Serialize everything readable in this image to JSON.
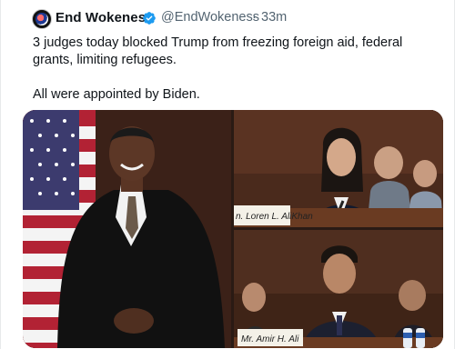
{
  "tweet": {
    "author_name": "End Wokeness",
    "handle": "@EndWokeness",
    "separator": "·",
    "time": "33m",
    "text_line1": "3 judges today blocked Trump from freezing foreign aid, federal grants, limiting refugees.",
    "text_line2": "All were appointed by Biden."
  },
  "media": {
    "top_right_nameplate": "n. Loren L. AliKhan",
    "bottom_right_nameplate": "Mr. Amir H. Ali"
  },
  "colors": {
    "verified": "#1d9bf0",
    "handle_gray": "#536471"
  },
  "icons": {
    "verified": "verified-badge-icon",
    "more": "more-icon"
  }
}
